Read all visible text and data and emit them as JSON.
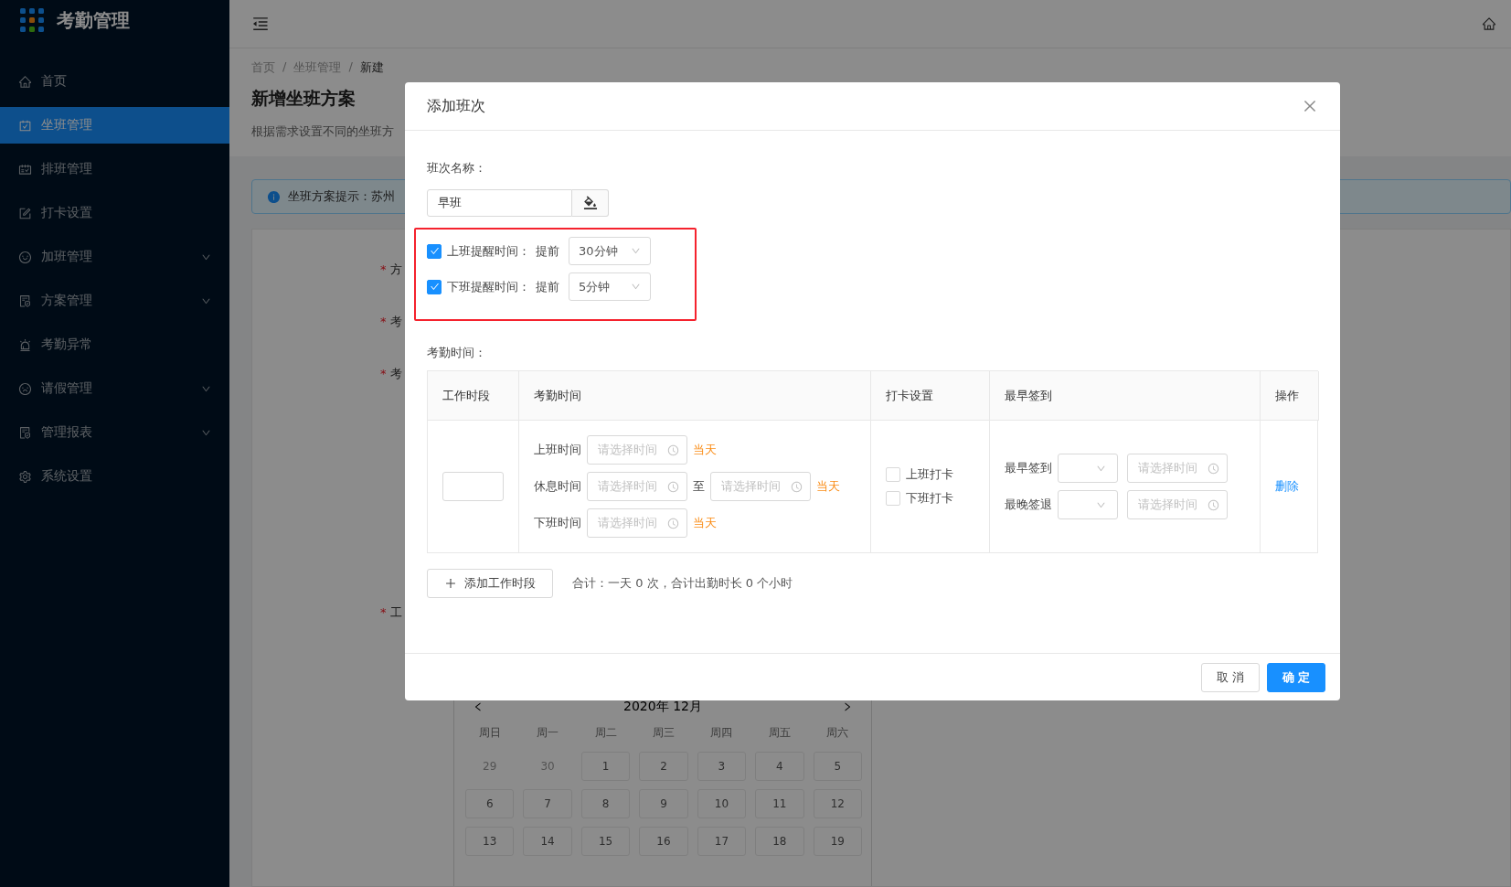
{
  "sidebar": {
    "title": "考勤管理",
    "items": [
      {
        "label": "首页",
        "selected": false,
        "has_submenu": false
      },
      {
        "label": "坐班管理",
        "selected": true,
        "has_submenu": false
      },
      {
        "label": "排班管理",
        "selected": false,
        "has_submenu": false
      },
      {
        "label": "打卡设置",
        "selected": false,
        "has_submenu": false
      },
      {
        "label": "加班管理",
        "selected": false,
        "has_submenu": true
      },
      {
        "label": "方案管理",
        "selected": false,
        "has_submenu": true
      },
      {
        "label": "考勤异常",
        "selected": false,
        "has_submenu": false
      },
      {
        "label": "请假管理",
        "selected": false,
        "has_submenu": true
      },
      {
        "label": "管理报表",
        "selected": false,
        "has_submenu": true
      },
      {
        "label": "系统设置",
        "selected": false,
        "has_submenu": false
      }
    ]
  },
  "page": {
    "breadcrumbs": [
      "首页",
      "坐班管理",
      "新建"
    ],
    "breadcrumb_separator": "/",
    "title": "新增坐班方案",
    "description": "根据需求设置不同的坐班方",
    "alert": "坐班方案提示：苏州",
    "form_labels": [
      {
        "mark": "*",
        "text": "方"
      },
      {
        "mark": "*",
        "text": "考"
      },
      {
        "mark": "*",
        "text": "考"
      },
      {
        "mark": "*",
        "text": "工"
      }
    ],
    "calendar": {
      "title": "2020年 12月",
      "weekdays": [
        "周日",
        "周一",
        "周二",
        "周三",
        "周四",
        "周五",
        "周六"
      ],
      "days": [
        {
          "label": "29",
          "in_month": false
        },
        {
          "label": "30",
          "in_month": false
        },
        {
          "label": "1",
          "in_month": true
        },
        {
          "label": "2",
          "in_month": true
        },
        {
          "label": "3",
          "in_month": true
        },
        {
          "label": "4",
          "in_month": true
        },
        {
          "label": "5",
          "in_month": true
        },
        {
          "label": "6",
          "in_month": true
        },
        {
          "label": "7",
          "in_month": true
        },
        {
          "label": "8",
          "in_month": true
        },
        {
          "label": "9",
          "in_month": true
        },
        {
          "label": "10",
          "in_month": true
        },
        {
          "label": "11",
          "in_month": true
        },
        {
          "label": "12",
          "in_month": true
        },
        {
          "label": "13",
          "in_month": true
        },
        {
          "label": "14",
          "in_month": true
        },
        {
          "label": "15",
          "in_month": true
        },
        {
          "label": "16",
          "in_month": true
        },
        {
          "label": "17",
          "in_month": true
        },
        {
          "label": "18",
          "in_month": true
        },
        {
          "label": "19",
          "in_month": true
        }
      ]
    }
  },
  "modal": {
    "title": "添加班次",
    "name_label": "班次名称：",
    "name_value": "早班",
    "reminders": [
      {
        "checked": true,
        "label": "上班提醒时间：",
        "prefix": "提前",
        "value": "30分钟"
      },
      {
        "checked": true,
        "label": "下班提醒时间：",
        "prefix": "提前",
        "value": "5分钟"
      }
    ],
    "section_label": "考勤时间：",
    "table": {
      "columns": [
        "工作时段",
        "考勤时间",
        "打卡设置",
        "最早签到",
        "操作"
      ],
      "times": [
        {
          "label": "上班时间",
          "placeholder": "请选择时间",
          "day": "当天"
        },
        {
          "label": "休息时间",
          "placeholder": "请选择时间",
          "to": "至",
          "end_placeholder": "请选择时间",
          "day": "当天"
        },
        {
          "label": "下班时间",
          "placeholder": "请选择时间",
          "day": "当天"
        }
      ],
      "punch": [
        {
          "label": "上班打卡",
          "checked": false
        },
        {
          "label": "下班打卡",
          "checked": false
        }
      ],
      "limits": [
        {
          "label": "最早签到",
          "placeholder": "请选择时间"
        },
        {
          "label": "最晚签退",
          "placeholder": "请选择时间"
        }
      ],
      "action": "删除"
    },
    "add_button": "添加工作时段",
    "summary": "合计：一天 0 次，合计出勤时长 0 个小时",
    "buttons": [
      {
        "label": "取 消",
        "kind": "default"
      },
      {
        "label": "确 定",
        "kind": "primary"
      }
    ]
  }
}
